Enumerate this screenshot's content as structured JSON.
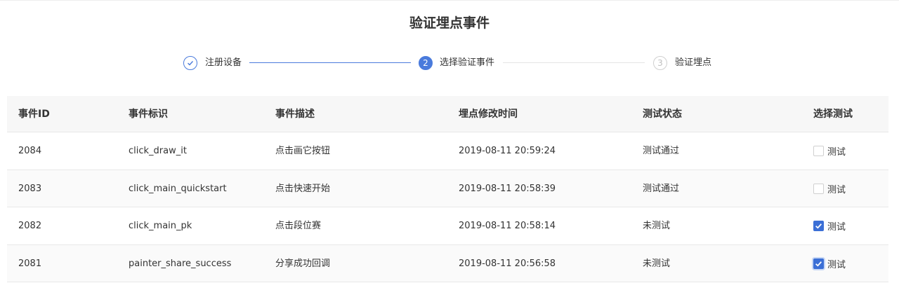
{
  "page": {
    "title": "验证埋点事件"
  },
  "steps": [
    {
      "index": "1",
      "label": "注册设备",
      "state": "done"
    },
    {
      "index": "2",
      "label": "选择验证事件",
      "state": "active"
    },
    {
      "index": "3",
      "label": "验证埋点",
      "state": "pending"
    }
  ],
  "table": {
    "columns": [
      "事件ID",
      "事件标识",
      "事件描述",
      "埋点修改时间",
      "测试状态",
      "选择测试"
    ],
    "rows": [
      {
        "id": "2084",
        "key": "click_draw_it",
        "desc": "点击画它按钮",
        "modified": "2019-08-11 20:59:24",
        "status": "测试通过",
        "test_label": "测试",
        "checked": false
      },
      {
        "id": "2083",
        "key": "click_main_quickstart",
        "desc": "点击快速开始",
        "modified": "2019-08-11 20:58:39",
        "status": "测试通过",
        "test_label": "测试",
        "checked": false
      },
      {
        "id": "2082",
        "key": "click_main_pk",
        "desc": "点击段位赛",
        "modified": "2019-08-11 20:58:14",
        "status": "未测试",
        "test_label": "测试",
        "checked": true
      },
      {
        "id": "2081",
        "key": "painter_share_success",
        "desc": "分享成功回调",
        "modified": "2019-08-11 20:56:58",
        "status": "未测试",
        "test_label": "测试",
        "checked": true
      }
    ]
  },
  "colors": {
    "accent": "#4a7bdc",
    "checkbox_on": "#3b6fd6"
  }
}
